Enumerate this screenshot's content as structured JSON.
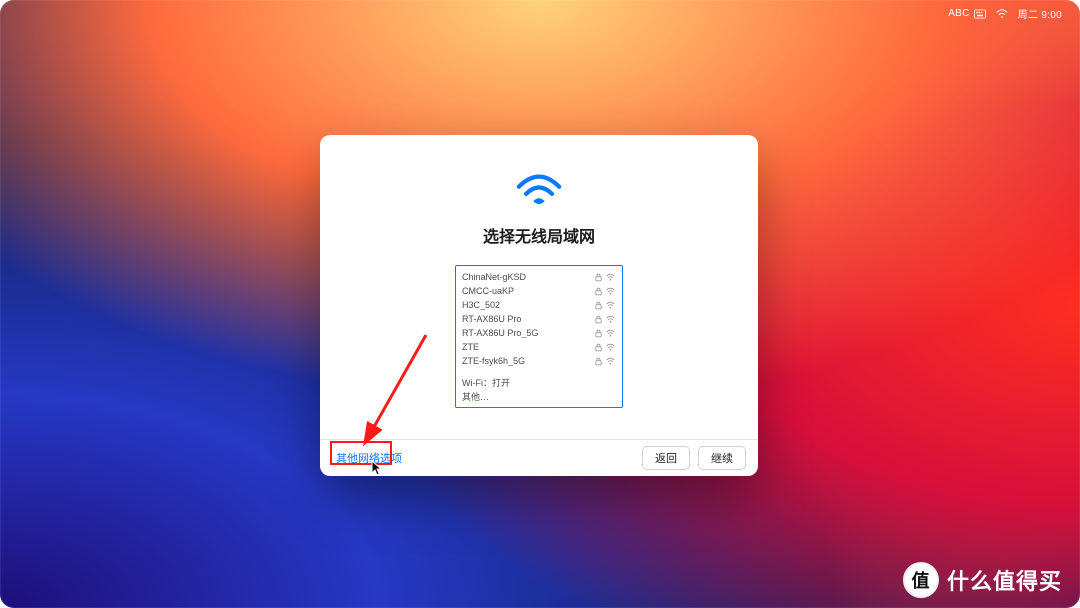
{
  "menubar": {
    "ime_label": "ABC",
    "datetime": "周二 9:00"
  },
  "sheet": {
    "title": "选择无线局域网",
    "networks": [
      {
        "name": "ChinaNet-gKSD",
        "locked": true
      },
      {
        "name": "CMCC-uaKP",
        "locked": true
      },
      {
        "name": "H3C_502",
        "locked": true
      },
      {
        "name": "RT-AX86U Pro",
        "locked": true
      },
      {
        "name": "RT-AX86U Pro_5G",
        "locked": true
      },
      {
        "name": "ZTE",
        "locked": true
      },
      {
        "name": "ZTE-fsyk6h_5G",
        "locked": true
      }
    ],
    "wifi_status": "Wi-Fi：打开",
    "other_label": "其他…",
    "footer": {
      "other_options": "其他网络选项",
      "back": "返回",
      "next": "继续"
    }
  },
  "watermark": {
    "badge": "值",
    "text": "什么值得买"
  }
}
